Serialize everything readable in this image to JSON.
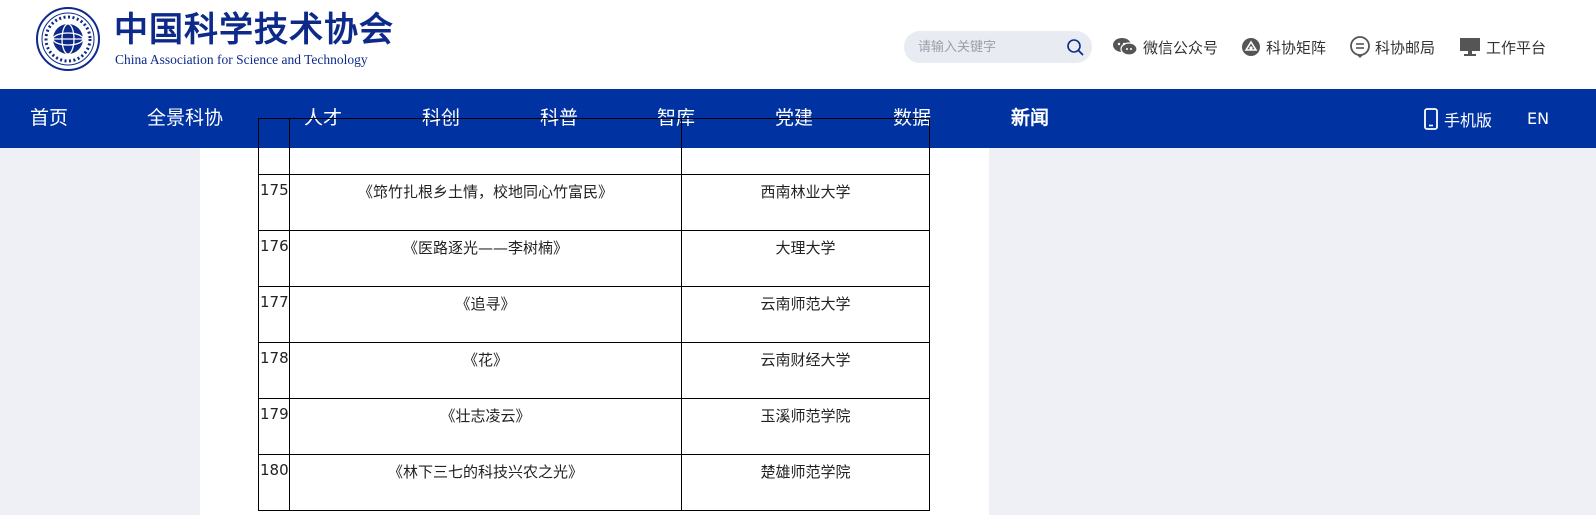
{
  "header": {
    "logo_cn": "中国科学技术协会",
    "logo_en": "China Association for Science and Technology",
    "search_placeholder": "请输入关键字",
    "links": [
      {
        "label": "微信公众号",
        "icon": "wechat-icon"
      },
      {
        "label": "科协矩阵",
        "icon": "matrix-icon"
      },
      {
        "label": "科协邮局",
        "icon": "mail-icon"
      },
      {
        "label": "工作平台",
        "icon": "monitor-icon"
      }
    ]
  },
  "nav": {
    "items": [
      "首页",
      "全景科协",
      "人才",
      "科创",
      "科普",
      "智库",
      "党建",
      "数据",
      "新闻"
    ],
    "active": "新闻",
    "mobile": "手机版",
    "lang": "EN"
  },
  "table": {
    "rows": [
      {
        "num": "",
        "title": "",
        "org": ""
      },
      {
        "num": "175",
        "title": "《筇竹扎根乡土情，校地同心竹富民》",
        "org": "西南林业大学"
      },
      {
        "num": "176",
        "title": "《医路逐光——李树楠》",
        "org": "大理大学"
      },
      {
        "num": "177",
        "title": "《追寻》",
        "org": "云南师范大学"
      },
      {
        "num": "178",
        "title": "《花》",
        "org": "云南财经大学"
      },
      {
        "num": "179",
        "title": "《壮志凌云》",
        "org": "玉溪师范学院"
      },
      {
        "num": "180",
        "title": "《林下三七的科技兴农之光》",
        "org": "楚雄师范学院"
      }
    ]
  },
  "colors": {
    "nav_bg": "#0033a1",
    "brand": "#0d2a8a",
    "page_bg": "#eef0f5"
  }
}
